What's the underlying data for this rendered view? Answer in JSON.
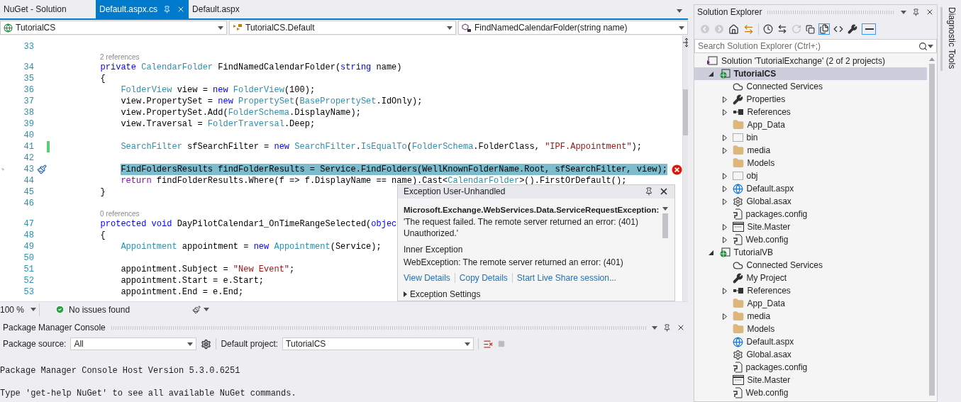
{
  "doc_tabs": [
    {
      "label": "NuGet - Solution",
      "selected": false
    },
    {
      "label": "Default.aspx.cs",
      "selected": true
    },
    {
      "label": "Default.aspx",
      "selected": false
    }
  ],
  "nav_bar": {
    "project": "TutorialCS",
    "class": "TutorialCS.Default",
    "member": "FindNamedCalendarFolder(string name)"
  },
  "code_lines": [
    {
      "kind": "code",
      "number": "33",
      "highlighted": false,
      "changed": false
    },
    {
      "kind": "lens",
      "text": "2 references"
    },
    {
      "kind": "code",
      "number": "34",
      "highlighted": false,
      "changed": false,
      "tokens": [
        {
          "kind": "keyword",
          "text": "        private "
        },
        {
          "kind": "type",
          "text": "CalendarFolder"
        },
        {
          "kind": "plain",
          "text": " FindNamedCalendarFolder("
        },
        {
          "kind": "keyword",
          "text": "string"
        },
        {
          "kind": "plain",
          "text": " name)"
        }
      ]
    },
    {
      "kind": "code",
      "number": "35",
      "highlighted": false,
      "changed": false,
      "tokens": [
        {
          "kind": "plain",
          "text": "        {"
        }
      ]
    },
    {
      "kind": "code",
      "number": "36",
      "highlighted": false,
      "changed": false,
      "tokens": [
        {
          "kind": "type",
          "text": "            FolderView"
        },
        {
          "kind": "plain",
          "text": " view = "
        },
        {
          "kind": "keyword",
          "text": "new "
        },
        {
          "kind": "type",
          "text": "FolderView"
        },
        {
          "kind": "plain",
          "text": "(100);"
        }
      ]
    },
    {
      "kind": "code",
      "number": "37",
      "highlighted": false,
      "changed": false,
      "tokens": [
        {
          "kind": "plain",
          "text": "            view.PropertySet = "
        },
        {
          "kind": "keyword",
          "text": "new "
        },
        {
          "kind": "type",
          "text": "PropertySet"
        },
        {
          "kind": "plain",
          "text": "("
        },
        {
          "kind": "type",
          "text": "BasePropertySet"
        },
        {
          "kind": "plain",
          "text": ".IdOnly);"
        }
      ]
    },
    {
      "kind": "code",
      "number": "38",
      "highlighted": false,
      "changed": false,
      "tokens": [
        {
          "kind": "plain",
          "text": "            view.PropertySet.Add("
        },
        {
          "kind": "type",
          "text": "FolderSchema"
        },
        {
          "kind": "plain",
          "text": ".DisplayName);"
        }
      ]
    },
    {
      "kind": "code",
      "number": "39",
      "highlighted": false,
      "changed": false,
      "tokens": [
        {
          "kind": "plain",
          "text": "            view.Traversal = "
        },
        {
          "kind": "type",
          "text": "FolderTraversal"
        },
        {
          "kind": "plain",
          "text": ".Deep;"
        }
      ]
    },
    {
      "kind": "code",
      "number": "40",
      "highlighted": false,
      "changed": false
    },
    {
      "kind": "code",
      "number": "41",
      "highlighted": false,
      "changed": true,
      "tokens": [
        {
          "kind": "type",
          "text": "            SearchFilter"
        },
        {
          "kind": "plain",
          "text": " sfSearchFilter = "
        },
        {
          "kind": "keyword",
          "text": "new "
        },
        {
          "kind": "type",
          "text": "SearchFilter"
        },
        {
          "kind": "plain",
          "text": "."
        },
        {
          "kind": "type",
          "text": "IsEqualTo"
        },
        {
          "kind": "plain",
          "text": "("
        },
        {
          "kind": "type",
          "text": "FolderSchema"
        },
        {
          "kind": "plain",
          "text": ".FolderClass, "
        },
        {
          "kind": "string",
          "text": "\"IPF.Appointment\""
        },
        {
          "kind": "plain",
          "text": ");"
        }
      ]
    },
    {
      "kind": "code",
      "number": "42",
      "highlighted": false,
      "changed": false
    },
    {
      "kind": "code",
      "number": "43",
      "highlighted": true,
      "changed": false,
      "tokens": [
        {
          "kind": "plain",
          "text": "            FindFoldersResults findFolderResults = Service.FindFolders(WellKnownFolderName.Root, sfSearchFilter, view);"
        }
      ]
    },
    {
      "kind": "code",
      "number": "44",
      "highlighted": false,
      "changed": false,
      "tokens": [
        {
          "kind": "control",
          "text": "            return"
        },
        {
          "kind": "plain",
          "text": " findFolderResults.Where(f => f.DisplayName == name).Cast<"
        },
        {
          "kind": "type",
          "text": "CalendarFolder"
        },
        {
          "kind": "plain",
          "text": ">().FirstOrDefault();"
        }
      ]
    },
    {
      "kind": "code",
      "number": "45",
      "highlighted": false,
      "changed": false,
      "tokens": [
        {
          "kind": "plain",
          "text": "        }"
        }
      ]
    },
    {
      "kind": "code",
      "number": "46",
      "highlighted": false,
      "changed": false
    },
    {
      "kind": "lens",
      "text": "0 references"
    },
    {
      "kind": "code",
      "number": "47",
      "highlighted": false,
      "changed": false,
      "tokens": [
        {
          "kind": "keyword",
          "text": "        protected void"
        },
        {
          "kind": "plain",
          "text": " DayPilotCalendar1_OnTimeRangeSelected("
        },
        {
          "kind": "keyword",
          "text": "objec"
        }
      ]
    },
    {
      "kind": "code",
      "number": "48",
      "highlighted": false,
      "changed": false,
      "tokens": [
        {
          "kind": "plain",
          "text": "        {"
        }
      ]
    },
    {
      "kind": "code",
      "number": "49",
      "highlighted": false,
      "changed": false,
      "tokens": [
        {
          "kind": "type",
          "text": "            Appointment"
        },
        {
          "kind": "plain",
          "text": " appointment = "
        },
        {
          "kind": "keyword",
          "text": "new "
        },
        {
          "kind": "type",
          "text": "Appointment"
        },
        {
          "kind": "plain",
          "text": "(Service);"
        }
      ]
    },
    {
      "kind": "code",
      "number": "50",
      "highlighted": false,
      "changed": false
    },
    {
      "kind": "code",
      "number": "51",
      "highlighted": false,
      "changed": false,
      "tokens": [
        {
          "kind": "plain",
          "text": "            appointment.Subject = "
        },
        {
          "kind": "string",
          "text": "\"New Event\""
        },
        {
          "kind": "plain",
          "text": ";"
        }
      ]
    },
    {
      "kind": "code",
      "number": "52",
      "highlighted": false,
      "changed": false,
      "tokens": [
        {
          "kind": "plain",
          "text": "            appointment.Start = e.Start;"
        }
      ]
    },
    {
      "kind": "code",
      "number": "53",
      "highlighted": false,
      "changed": false,
      "tokens": [
        {
          "kind": "plain",
          "text": "            appointment.End = e.End;"
        }
      ]
    }
  ],
  "exception_popup": {
    "title": "Exception User-Unhandled",
    "exception_type": "Microsoft.Exchange.WebServices.Data.ServiceRequestException:",
    "message": "'The request failed. The remote server returned an error: (401) Unauthorized.'",
    "inner_heading": "Inner Exception",
    "inner_message": "WebException: The remote server returned an error: (401)",
    "links": [
      "View Details",
      "Copy Details",
      "Start Live Share session..."
    ],
    "settings": "Exception Settings"
  },
  "status_bar": {
    "zoom": "100 %",
    "issues": "No issues found"
  },
  "console": {
    "title": "Package Manager Console",
    "source_label": "Package source:",
    "source": "All",
    "project_label": "Default project:",
    "project": "TutorialCS",
    "output": [
      "Package Manager Console Host Version 5.3.0.6251",
      "Type 'get-help NuGet' to see all available NuGet commands."
    ]
  },
  "solution_explorer": {
    "title": "Solution Explorer",
    "search_placeholder": "Search Solution Explorer (Ctrl+;)",
    "tree": [
      {
        "label": "Solution 'TutorialExchange' (2 of 2 projects)",
        "kind": "solution",
        "selected": false,
        "children": [
          {
            "label": "TutorialCS",
            "kind": "project",
            "selected": true,
            "expanded": true,
            "children": [
              {
                "label": "Connected Services",
                "kind": "cloud",
                "selected": false
              },
              {
                "label": "Properties",
                "kind": "wrench",
                "selected": false,
                "expanded": false
              },
              {
                "label": "References",
                "kind": "references",
                "selected": false,
                "expanded": false
              },
              {
                "label": "App_Data",
                "kind": "folder",
                "selected": false
              },
              {
                "label": "bin",
                "kind": "hidden-folder",
                "selected": false,
                "expanded": false
              },
              {
                "label": "media",
                "kind": "folder",
                "selected": false,
                "expanded": false
              },
              {
                "label": "Models",
                "kind": "folder",
                "selected": false
              },
              {
                "label": "obj",
                "kind": "hidden-folder",
                "selected": false,
                "expanded": false
              },
              {
                "label": "Default.aspx",
                "kind": "web",
                "selected": false,
                "expanded": false
              },
              {
                "label": "Global.asax",
                "kind": "gear",
                "selected": false,
                "expanded": false
              },
              {
                "label": "packages.config",
                "kind": "config",
                "selected": false
              },
              {
                "label": "Site.Master",
                "kind": "master",
                "selected": false,
                "expanded": false
              },
              {
                "label": "Web.config",
                "kind": "config",
                "selected": false,
                "expanded": false
              }
            ]
          },
          {
            "label": "TutorialVB",
            "kind": "project",
            "selected": false,
            "expanded": true,
            "children": [
              {
                "label": "Connected Services",
                "kind": "cloud",
                "selected": false
              },
              {
                "label": "My Project",
                "kind": "wrench",
                "selected": false
              },
              {
                "label": "References",
                "kind": "references",
                "selected": false,
                "expanded": false
              },
              {
                "label": "App_Data",
                "kind": "folder",
                "selected": false
              },
              {
                "label": "media",
                "kind": "folder",
                "selected": false,
                "expanded": false
              },
              {
                "label": "Models",
                "kind": "folder",
                "selected": false
              },
              {
                "label": "Default.aspx",
                "kind": "web",
                "selected": false
              },
              {
                "label": "Global.asax",
                "kind": "gear",
                "selected": false
              },
              {
                "label": "packages.config",
                "kind": "config",
                "selected": false
              },
              {
                "label": "Site.Master",
                "kind": "master",
                "selected": false
              },
              {
                "label": "Web.config",
                "kind": "config",
                "selected": false
              }
            ]
          }
        ]
      }
    ]
  },
  "side_tab": "Diagnostic Tools"
}
